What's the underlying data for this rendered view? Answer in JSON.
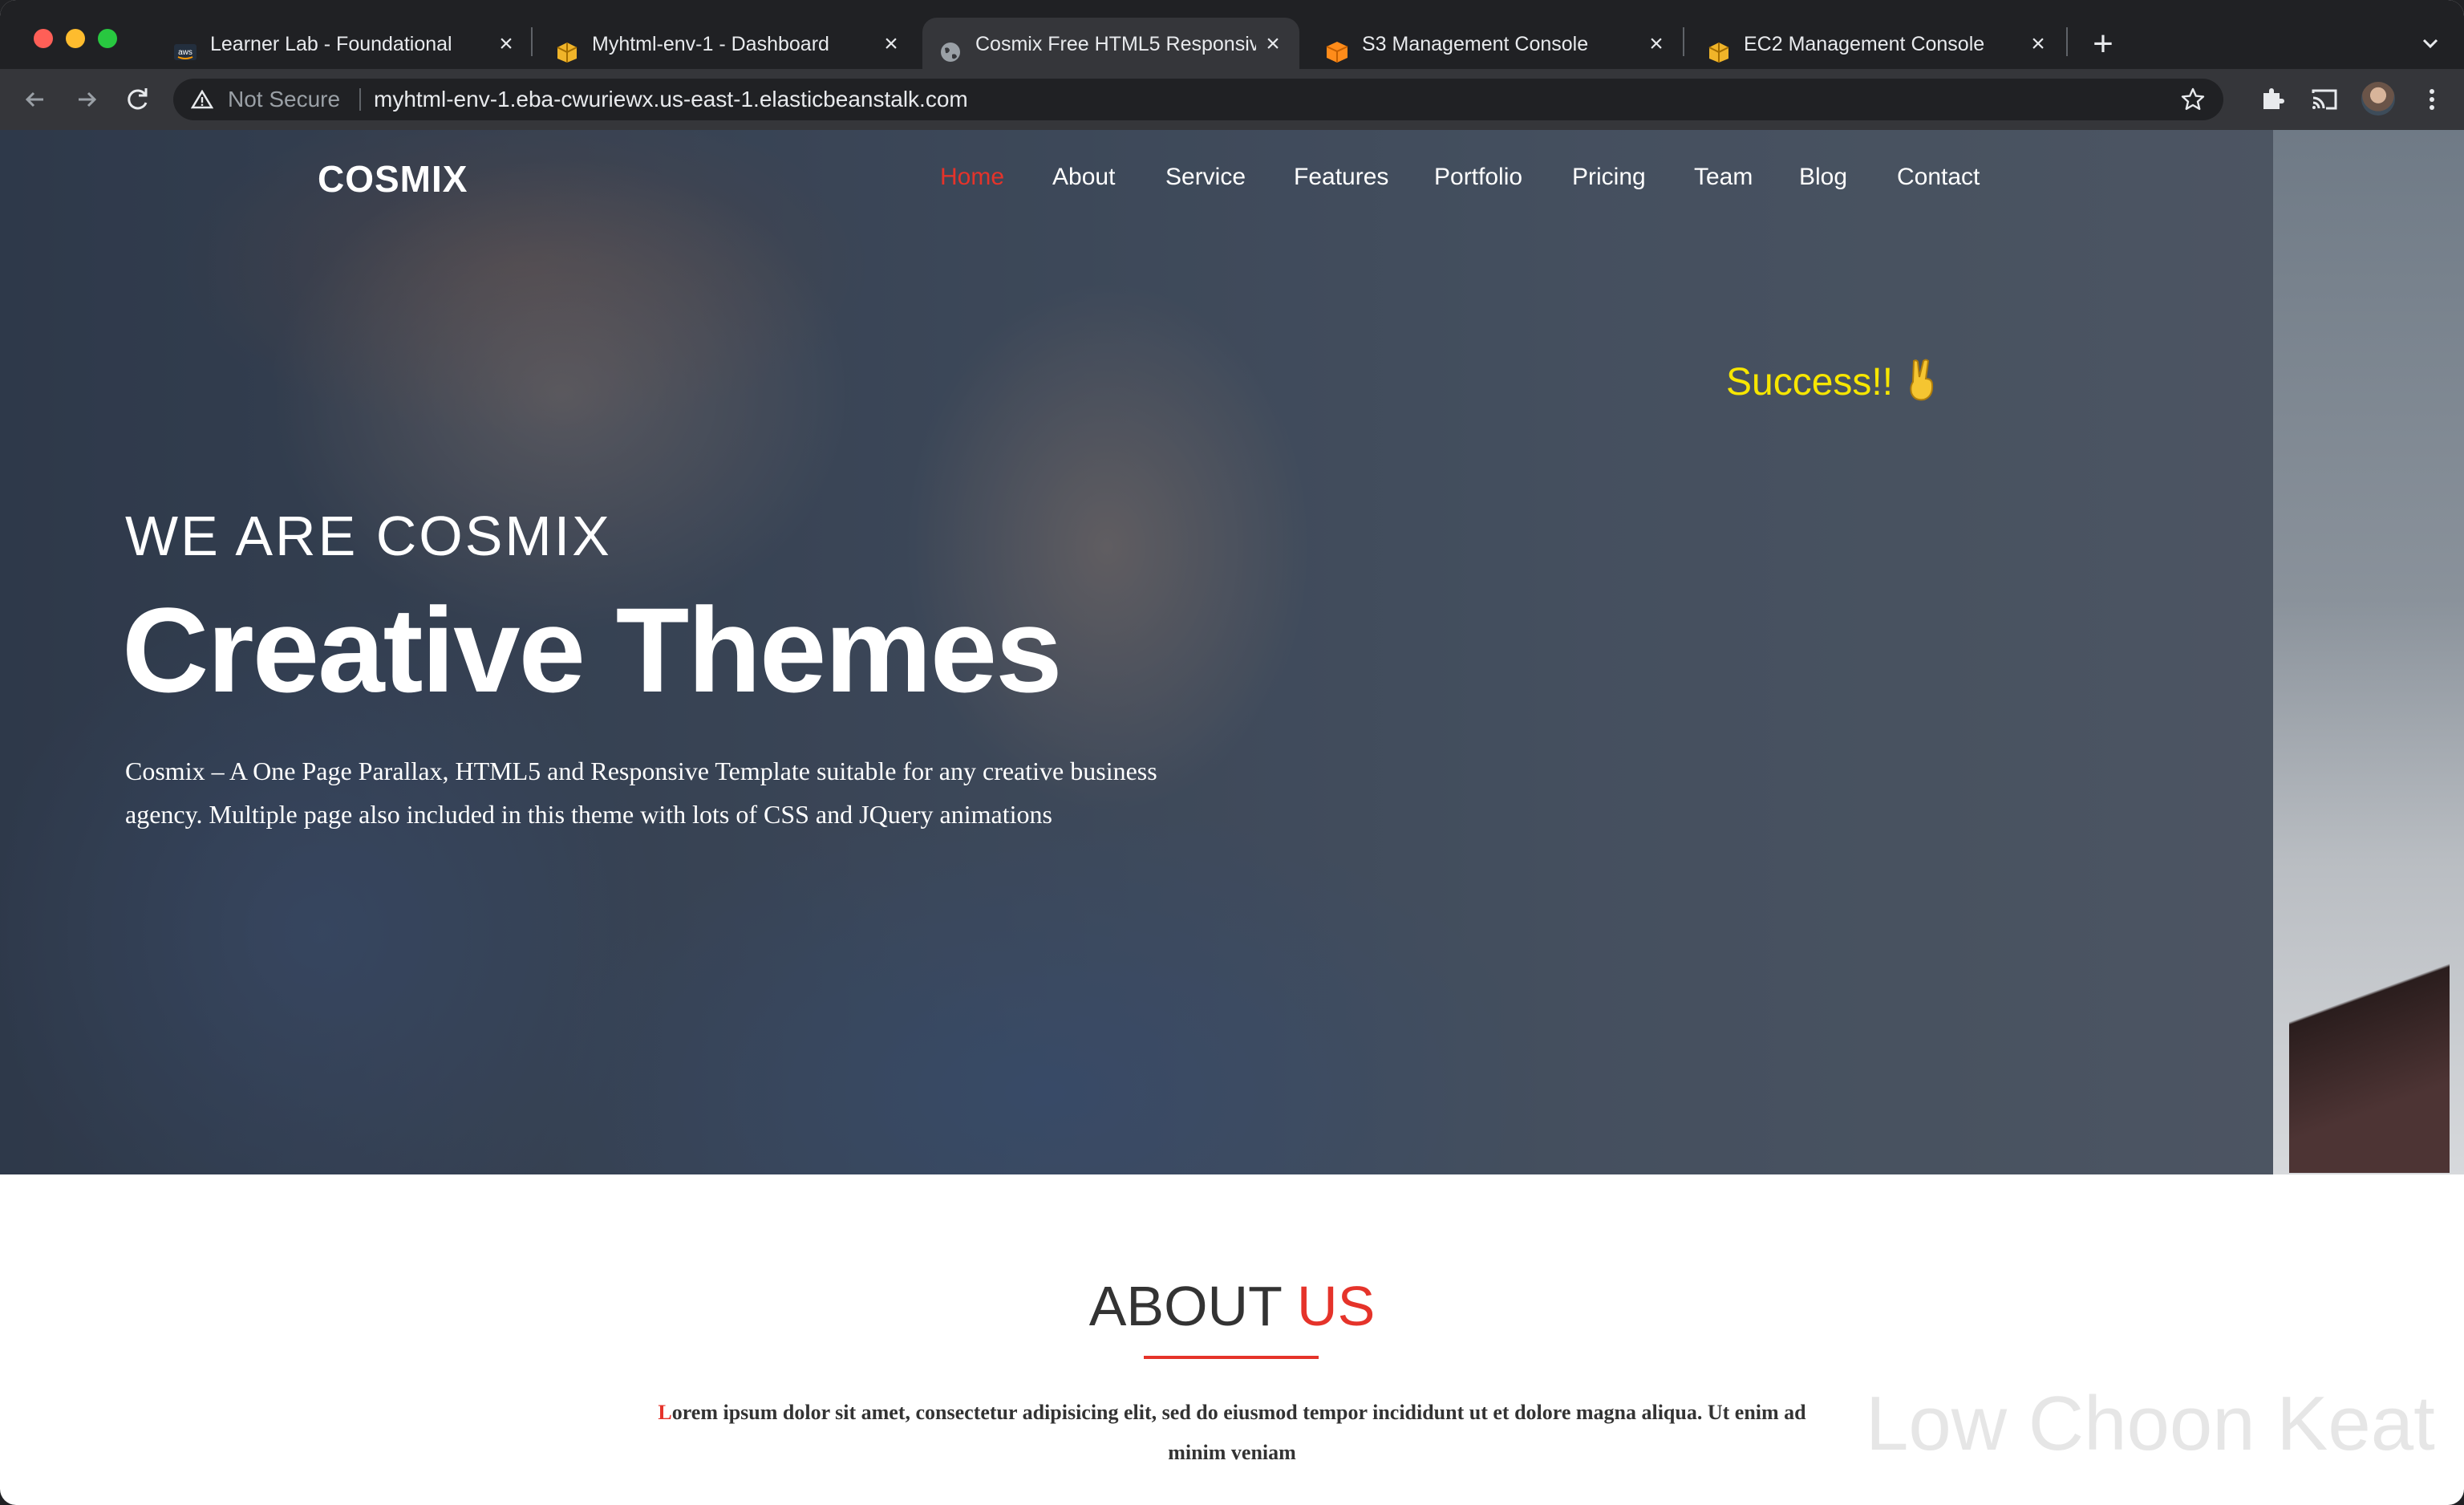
{
  "browser": {
    "tabs": [
      {
        "title": "Learner Lab - Foundational Ser",
        "favicon": "aws-icon"
      },
      {
        "title": "Myhtml-env-1 - Dashboard",
        "favicon": "beanstalk-icon"
      },
      {
        "title": "Cosmix Free HTML5 Responsiv",
        "favicon": "globe-icon",
        "active": true
      },
      {
        "title": "S3 Management Console",
        "favicon": "s3-icon"
      },
      {
        "title": "EC2 Management Console",
        "favicon": "ec2-icon"
      }
    ],
    "security_label": "Not Secure",
    "url": "myhtml-env-1.eba-cwuriewx.us-east-1.elasticbeanstalk.com",
    "aws_label": "aws"
  },
  "site": {
    "logo": "COSMIX",
    "nav": [
      "Home",
      "About",
      "Service",
      "Features",
      "Portfolio",
      "Pricing",
      "Team",
      "Blog",
      "Contact"
    ],
    "nav_active": "Home",
    "success": "Success!!",
    "hero": {
      "subtitle": "WE ARE COSMIX",
      "title": "Creative Themes",
      "description": "Cosmix – A One Page Parallax, HTML5 and Responsive Template suitable for any creative business agency. Multiple page also included in this theme with lots of CSS and JQuery animations"
    },
    "about": {
      "title_main": "ABOUT",
      "title_accent": "US",
      "text_first_letter": "L",
      "text_rest": "orem ipsum dolor sit amet, consectetur adipisicing elit, sed do eiusmod tempor incididunt ut et dolore magna aliqua. Ut enim ad minim veniam"
    },
    "watermark": "Low Choon Keat"
  },
  "colors": {
    "accent": "#e5332a",
    "success": "#f7e600",
    "chrome_dark": "#202124",
    "chrome_toolbar": "#35363a"
  }
}
